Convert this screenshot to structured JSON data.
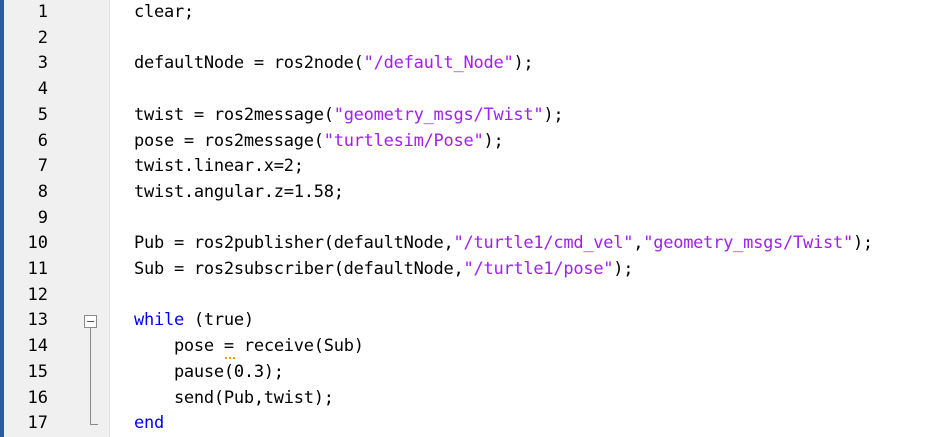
{
  "editor": {
    "lines": [
      {
        "n": "1",
        "parts": [
          {
            "t": "clear;",
            "c": "plain"
          }
        ]
      },
      {
        "n": "2",
        "parts": []
      },
      {
        "n": "3",
        "parts": [
          {
            "t": "defaultNode = ros2node(",
            "c": "plain"
          },
          {
            "t": "\"/default_Node\"",
            "c": "str"
          },
          {
            "t": ");",
            "c": "plain"
          }
        ]
      },
      {
        "n": "4",
        "parts": []
      },
      {
        "n": "5",
        "parts": [
          {
            "t": "twist = ros2message(",
            "c": "plain"
          },
          {
            "t": "\"geometry_msgs/Twist\"",
            "c": "str"
          },
          {
            "t": ");",
            "c": "plain"
          }
        ]
      },
      {
        "n": "6",
        "parts": [
          {
            "t": "pose = ros2message(",
            "c": "plain"
          },
          {
            "t": "\"turtlesim/Pose\"",
            "c": "str"
          },
          {
            "t": ");",
            "c": "plain"
          }
        ]
      },
      {
        "n": "7",
        "parts": [
          {
            "t": "twist.linear.x=2;",
            "c": "plain"
          }
        ]
      },
      {
        "n": "8",
        "parts": [
          {
            "t": "twist.angular.z=1.58;",
            "c": "plain"
          }
        ]
      },
      {
        "n": "9",
        "parts": []
      },
      {
        "n": "10",
        "parts": [
          {
            "t": "Pub = ros2publisher(defaultNode,",
            "c": "plain"
          },
          {
            "t": "\"/turtle1/cmd_vel\"",
            "c": "str"
          },
          {
            "t": ",",
            "c": "plain"
          },
          {
            "t": "\"geometry_msgs/Twist\"",
            "c": "str"
          },
          {
            "t": ");",
            "c": "plain"
          }
        ]
      },
      {
        "n": "11",
        "parts": [
          {
            "t": "Sub = ros2subscriber(defaultNode,",
            "c": "plain"
          },
          {
            "t": "\"/turtle1/pose\"",
            "c": "str"
          },
          {
            "t": ");",
            "c": "plain"
          }
        ]
      },
      {
        "n": "12",
        "parts": []
      },
      {
        "n": "13",
        "parts": [
          {
            "t": "while",
            "c": "kw"
          },
          {
            "t": " (true)",
            "c": "plain"
          }
        ]
      },
      {
        "n": "14",
        "parts": [
          {
            "t": "    pose ",
            "c": "plain"
          },
          {
            "t": "=",
            "c": "warn"
          },
          {
            "t": " receive(Sub)",
            "c": "plain"
          }
        ]
      },
      {
        "n": "15",
        "parts": [
          {
            "t": "    pause(0.3);",
            "c": "plain"
          }
        ]
      },
      {
        "n": "16",
        "parts": [
          {
            "t": "    send(Pub,twist);",
            "c": "plain"
          }
        ]
      },
      {
        "n": "17",
        "parts": [
          {
            "t": "end",
            "c": "kw"
          }
        ]
      }
    ]
  },
  "colors": {
    "keyword": "#0000ff",
    "string": "#a020f0",
    "plain": "#000000",
    "warning": "#e8a100",
    "gutter": "#f0f0f0"
  },
  "icons": {
    "fold": "collapse-block-icon"
  }
}
